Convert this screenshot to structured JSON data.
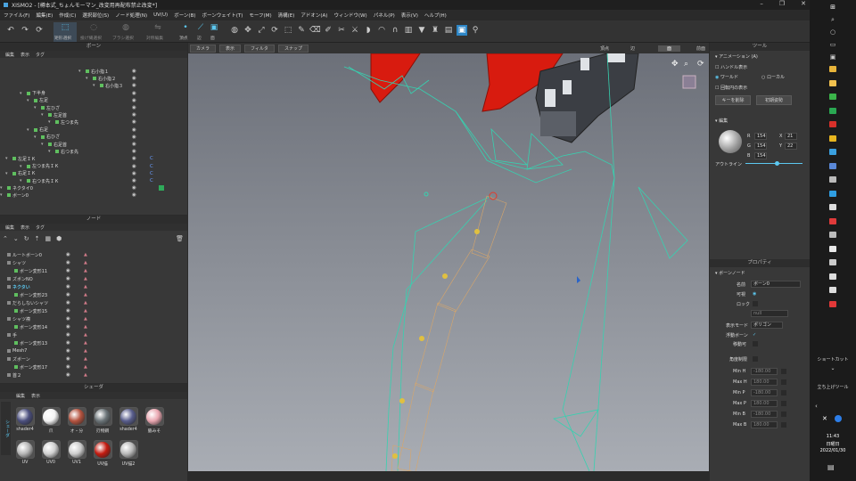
{
  "window": {
    "title": "XISMO2 - [樽本式_ちょんモーマン_改変用再配布禁止改変*]"
  },
  "menu": [
    "ファイル(F)",
    "編集(E)",
    "作成(C)",
    "選択部位(S)",
    "ノード処理(N)",
    "UV(U)",
    "ボーン(B)",
    "ボーンウェイト(T)",
    "モーフ(M)",
    "清構(E)",
    "アドオン(A)",
    "ウィンドウ(W)",
    "パネル(P)",
    "表示(V)",
    "ヘルプ(H)"
  ],
  "toolbar": {
    "select_labels": [
      "矩形選択",
      "投げ縄選択",
      "ブラシ選択",
      "対称編集"
    ],
    "mode_labels": [
      "頂点",
      "辺",
      "面"
    ]
  },
  "bone_panel": {
    "title": "ボーン",
    "menu": [
      "編集",
      "表示",
      "タグ"
    ],
    "items": [
      "右小指１",
      "右小指２",
      "右小指３",
      "下半身",
      "左足",
      "左ひざ",
      "左足首",
      "左つま先",
      "右足",
      "右ひざ",
      "右足首",
      "右つま先",
      "左足ＩＫ",
      "左つま先ＩＫ",
      "右足ＩＫ",
      "右つま先ＩＫ",
      "ネクタイ0",
      "ボーン0"
    ]
  },
  "node_panel": {
    "title": "ノード",
    "menu": [
      "編集",
      "表示",
      "タグ"
    ],
    "items": [
      "ルートボーン0",
      "シャツ",
      "ボーン変形11",
      "ズボンNO",
      "ネクタい",
      "ボーン変形23",
      "だらしないシャツ",
      "ボーン変形15",
      "シャツ襟",
      "ボーン変形14",
      "手",
      "ボーン変形13",
      "Mesh7",
      "ズボーン",
      "ボーン変形17",
      "首２"
    ]
  },
  "shader_panel": {
    "title": "シェーダ",
    "menu": [
      "編集",
      "表示"
    ],
    "side_tab": "シェーダ",
    "items": [
      {
        "label": "shader4",
        "color": "#4b4f7e"
      },
      {
        "label": "爪",
        "color": "#f2f2f2"
      },
      {
        "label": "オ・分",
        "color": "#b5533f"
      },
      {
        "label": "刃物鋼",
        "color": "#6b7478"
      },
      {
        "label": "shader4",
        "color": "#585d8c"
      },
      {
        "label": "脇みそ",
        "color": "#e9a6b0"
      },
      {
        "label": "UV",
        "color": "#b5b5b5"
      },
      {
        "label": "UV0",
        "color": "#d0d0d0"
      },
      {
        "label": "UV1",
        "color": "#cccccc"
      },
      {
        "label": "UV描",
        "color": "#c41b10"
      },
      {
        "label": "UV描2",
        "color": "#b8b8b8"
      }
    ]
  },
  "viewport": {
    "menus": [
      "カメラ",
      "表示",
      "フィルタ",
      "スナップ"
    ],
    "view_labels": [
      "頂点",
      "辺",
      "面",
      "前面"
    ]
  },
  "tool_panel": {
    "title": "ツール",
    "animation_header": "アニメーション (A)",
    "handle_display": "ハンドル表示",
    "world": "ワールド",
    "local": "ローカル",
    "rotation_circle": "回転円の表示",
    "key_delete": "キーを削除",
    "initial_pose": "初期姿勢",
    "edit_header": "編集",
    "rgb": {
      "R": "154",
      "G": "154",
      "B": "154"
    },
    "xy": {
      "X": "21",
      "Y": "22"
    },
    "outline": "アウトライン"
  },
  "property_panel": {
    "title": "プロパティ",
    "section": "ボーンノード",
    "name_label": "名前",
    "name_value": "ボーン0",
    "visible_label": "可視",
    "lock_label": "ロック",
    "lock_select": "null",
    "display_mode_label": "表示モード",
    "display_mode_value": "ポリゴン",
    "float_bone_label": "浮動ボーン",
    "movable_label": "移動可",
    "angle_limit_label": "角度制限",
    "limits": [
      {
        "label": "Min H",
        "value": "-180.00"
      },
      {
        "label": "Max H",
        "value": "180.00"
      },
      {
        "label": "Min P",
        "value": "-180.00"
      },
      {
        "label": "Max P",
        "value": "180.00"
      },
      {
        "label": "Min B",
        "value": "-180.00"
      },
      {
        "label": "Max B",
        "value": "180.00"
      }
    ]
  },
  "taskbar": {
    "shortcut": "ショートカット",
    "startup": "立ち上げツール",
    "time": "11:43",
    "day": "日曜日",
    "date": "2022/01/30"
  }
}
